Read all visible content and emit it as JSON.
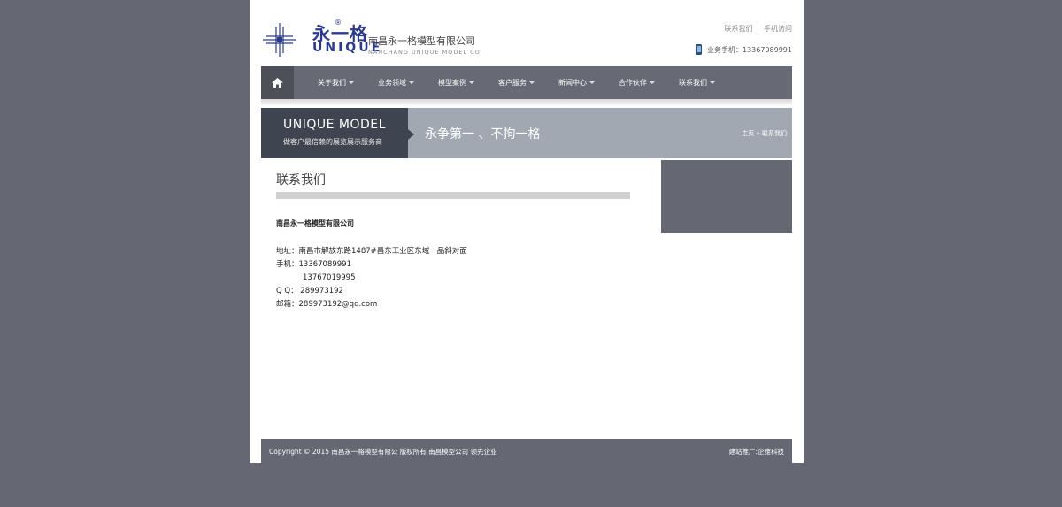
{
  "header": {
    "logo_cn": "永一格",
    "logo_en": "UNIQUE",
    "reg_mark": "®",
    "company_cn": "南昌永一格模型有限公司",
    "company_en": "NANCHANG UNIQUE MODEL CO.",
    "top_links": [
      "联系我们",
      "手机访问"
    ],
    "phone_label": "业务手机：13367089991"
  },
  "nav": {
    "items": [
      "关于我们",
      "业务领域",
      "模型案例",
      "客户服务",
      "新闻中心",
      "合作伙伴",
      "联系我们"
    ]
  },
  "banner": {
    "title_en": "UNIQUE MODEL",
    "subtitle": "做客户最信赖的展览展示服务商",
    "slogan": "永争第一 、不拘一格",
    "breadcrumb_home": "主页",
    "breadcrumb_sep": "»",
    "breadcrumb_current": "联系我们"
  },
  "content": {
    "title": "联系我们",
    "company": "南昌永一格模型有限公司",
    "address": "地址：南昌市解放东路1487#昌东工业区东域一品斜对面",
    "phone1": "手机：13367089991",
    "phone2": "13767019995",
    "qq": "Q Q： 289973192",
    "email": "邮箱：289973192@qq.com"
  },
  "footer": {
    "copyright": "Copyright © 2015 南昌永一格模型有限公 版权所有  南昌模型公司 领先企业",
    "credit": "建站推广:企维科技"
  },
  "colors": {
    "background": "#656872",
    "nav": "#676a74",
    "banner_left": "#3f4550",
    "banner_right": "#a1a8b2",
    "brand": "#2c3a8a"
  }
}
